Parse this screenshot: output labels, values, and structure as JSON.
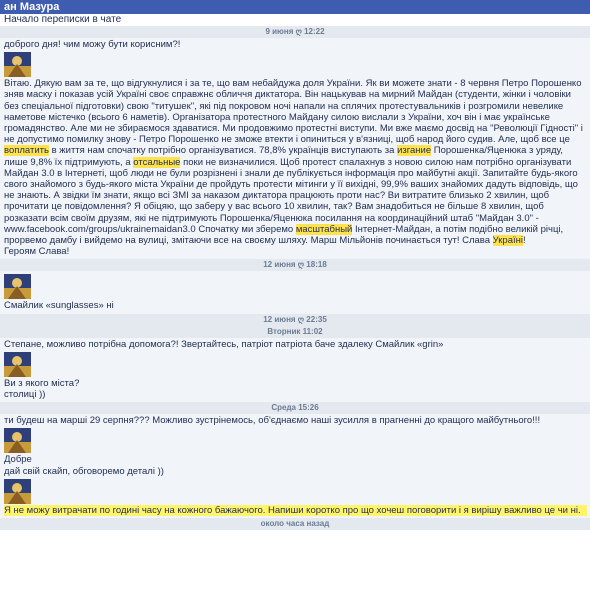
{
  "header": {
    "title": "ан Мазура",
    "subtitle": "Начало переписки в чате"
  },
  "timestamps": {
    "t1": "9 июня ღ 12:22",
    "t2": "12 июня ღ 18:18",
    "t3": "12 июня ღ 22:35",
    "t4": "Вторник 11:02",
    "t5": "Среда 15:26",
    "t6": "около часа назад"
  },
  "messages": {
    "m1": "доброго дня! чим можу бути корисним?!",
    "m2_intro": "Вітаю. Дякую вам за те, що відгукнулися і за те, що вам небайдужа доля України. Як ви можете знати - 8 червня Петро Порошенко зняв маску і показав усій Україні своє справжнє обличчя диктатора. Він нацькував на мирний Майдан (студенти, жінки і чоловіки без спеціальної підготовки) свою \"титушек\", які під покровом ночі напали на сплячих протестувальників і розгромили невеликe наметове містечко (всього 6 наметів). Організатора протестного Майдану силою вислали з України, хоч він і має українське громадянство. Але ми не збираємося здаватися. Ми продовжимо протестні виступи. Ми вже маємо досвід на \"Революції Гідності\" і не допустимо помилку знову - Петро Порошенко не зможе втекти і опиниться у в'язниці, щоб народ його судив. Але, щоб все це ",
    "m2_hl1": "воплатить",
    "m2_a": " в життя нам спочатку потрібно організуватися. 78,8% українців виступають за ",
    "m2_hl2": "изгание",
    "m2_b": " Порошенка/Яценюка з уряду, лише 9,8% їх підтримують, а ",
    "m2_hl3": "отсальные",
    "m2_c": " поки не визначилися. Щоб протест спалахнув з новою силою нам потрібно організувати Майдан 3.0 в Інтернеті, щоб люди не були розрізнені і знали де публікується інформація про майбутні акції. Запитайте будь-якого свого знайомого з будь-якого міста України де пройдуть протести мітинги у її вихідні, 99,9% ваших знайомих дадуть відповідь, що не знають. А звідки їм знати, якщо всі ЗМІ за наказом диктатора працюють проти нас? Ви витратите близько 2 хвилин, щоб прочитати це повідомлення? Я обіцяю, що заберу у вас всього 10 хвилин, так? Вам знадобиться не більше 8 хвилин, щоб розказати всім своїм друзям, які не підтримують Порошенка/Яценюка посилання на координаційний штаб \"Майдан 3.0\" - www.facebook.com/groups/ukrainemaidan3.0 Спочатку ми зберемо ",
    "m2_hl4": "масштабный",
    "m2_d": " Інтернет-Майдан, а потім подібно великій річці, прорвемо дамбу і вийдемо на вулиці, змітаючи все на своєму шляху. Марш Мільйонів починається тут! Слава ",
    "m2_hl5": "Україні",
    "m2_end": "!",
    "m3": "Героям Слава!",
    "m4": "Смайлик «sunglasses» ні",
    "m5": "Степане, можливо потрібна допомога?! Звертайтесь, патріот патріота баче здалеку Смайлик «grin»",
    "m6a": "Ви з якого міста?",
    "m6b": "столиці ))",
    "m7": "ти будеш на марші 29 серпня??? Можливо зустрінемось, об'єднаємо наші зусилля в прагненні до кращого майбутнього!!!",
    "m8a": "Добре",
    "m8b": "дай свій скайп, обговоремо деталі ))",
    "m9": "Я не можу витрачати по годині часу на кожного бажаючого. Напиши коротко про що хочеш поговорити і я вирішу важливо це чи ні."
  }
}
